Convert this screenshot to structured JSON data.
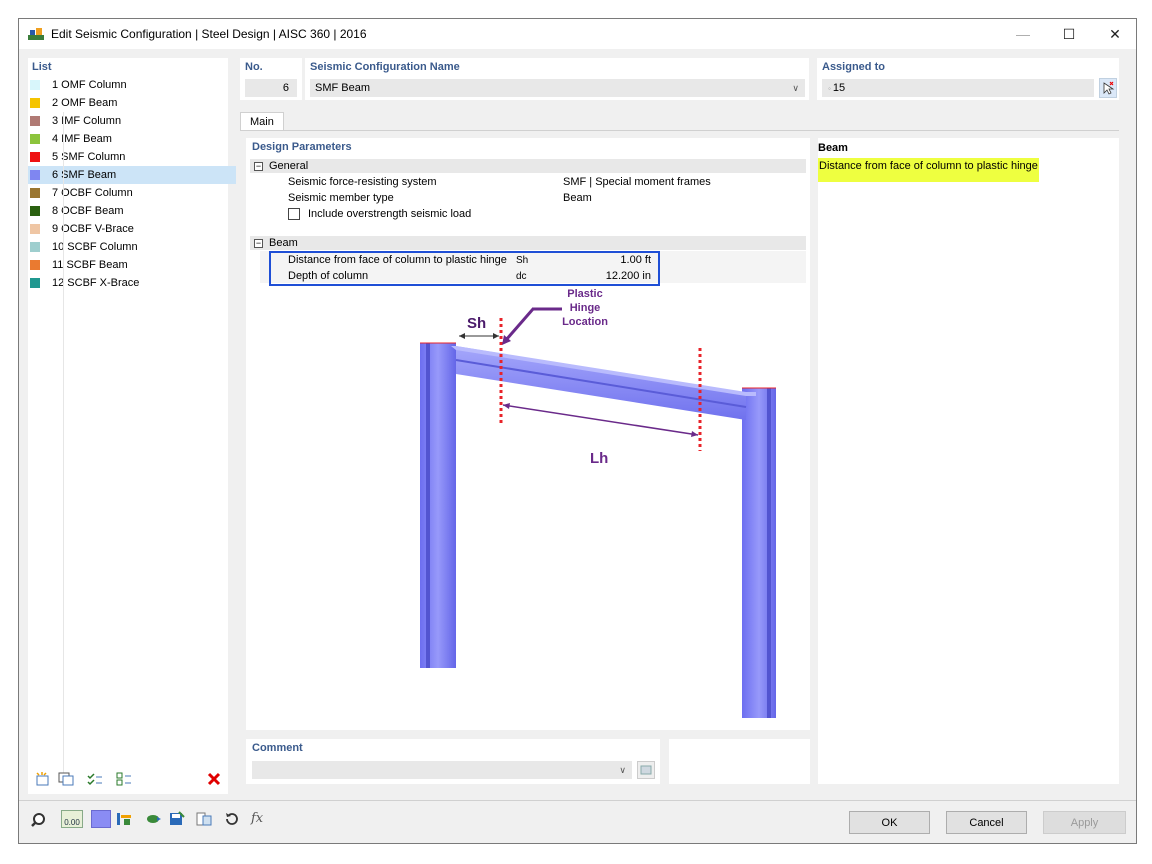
{
  "window": {
    "title": "Edit Seismic Configuration | Steel Design | AISC 360 | 2016",
    "controls": {
      "minimize": "—",
      "maximize": "☐",
      "close": "✕"
    }
  },
  "list": {
    "header": "List",
    "items": [
      {
        "label": "1 OMF Column",
        "color": "#d8f6fb"
      },
      {
        "label": "2 OMF Beam",
        "color": "#f5c400"
      },
      {
        "label": "3 IMF Column",
        "color": "#b07a74"
      },
      {
        "label": "4 IMF Beam",
        "color": "#8cc43c"
      },
      {
        "label": "5 SMF Column",
        "color": "#ee1111"
      },
      {
        "label": "6 SMF Beam",
        "color": "#7f86f1",
        "selected": true
      },
      {
        "label": "7 OCBF Column",
        "color": "#9a7630"
      },
      {
        "label": "8 OCBF Beam",
        "color": "#2a6010"
      },
      {
        "label": "9 OCBF V-Brace",
        "color": "#efc6a4"
      },
      {
        "label": "10 SCBF Column",
        "color": "#9ecece"
      },
      {
        "label": "11 SCBF Beam",
        "color": "#ea7a30"
      },
      {
        "label": "12 SCBF X-Brace",
        "color": "#209890"
      }
    ]
  },
  "no": {
    "label": "No.",
    "value": "6"
  },
  "name": {
    "label": "Seismic Configuration Name",
    "value": "SMF Beam"
  },
  "assigned": {
    "label": "Assigned to",
    "value": "15"
  },
  "tabs": {
    "main": "Main"
  },
  "design": {
    "title": "Design Parameters",
    "general": {
      "label": "General",
      "toggle": "−",
      "rows": [
        {
          "label": "Seismic force-resisting system",
          "value": "SMF | Special moment frames"
        },
        {
          "label": "Seismic member type",
          "value": "Beam"
        }
      ],
      "checkbox_label": "Include overstrength seismic load"
    },
    "beam": {
      "label": "Beam",
      "toggle": "−",
      "rows": [
        {
          "label": "Distance from face of column to plastic hinge",
          "sym": "Sh",
          "value": "1.00 ft"
        },
        {
          "label": "Depth of column",
          "sym": "dc",
          "value": "12.200 in"
        }
      ]
    }
  },
  "figure": {
    "label_sh": "Sh",
    "label_lh": "Lh",
    "callout": [
      "Plastic",
      "Hinge",
      "Location"
    ]
  },
  "info": {
    "title": "Beam",
    "text": "Distance from face of column to plastic hinge"
  },
  "comment": {
    "label": "Comment",
    "value": ""
  },
  "buttons": {
    "ok": "OK",
    "cancel": "Cancel",
    "apply": "Apply"
  },
  "toolbar": {
    "units_label": "0.00"
  },
  "colors": {
    "accent_blue": "#1f4fd6",
    "selected_row": "#cce4f7",
    "header_text": "#3a5a8c",
    "hinge_red": "#e8232a",
    "callout_purple": "#6a2a8a",
    "member": "#8a8cf4",
    "note_highlight": "#eeff40"
  }
}
